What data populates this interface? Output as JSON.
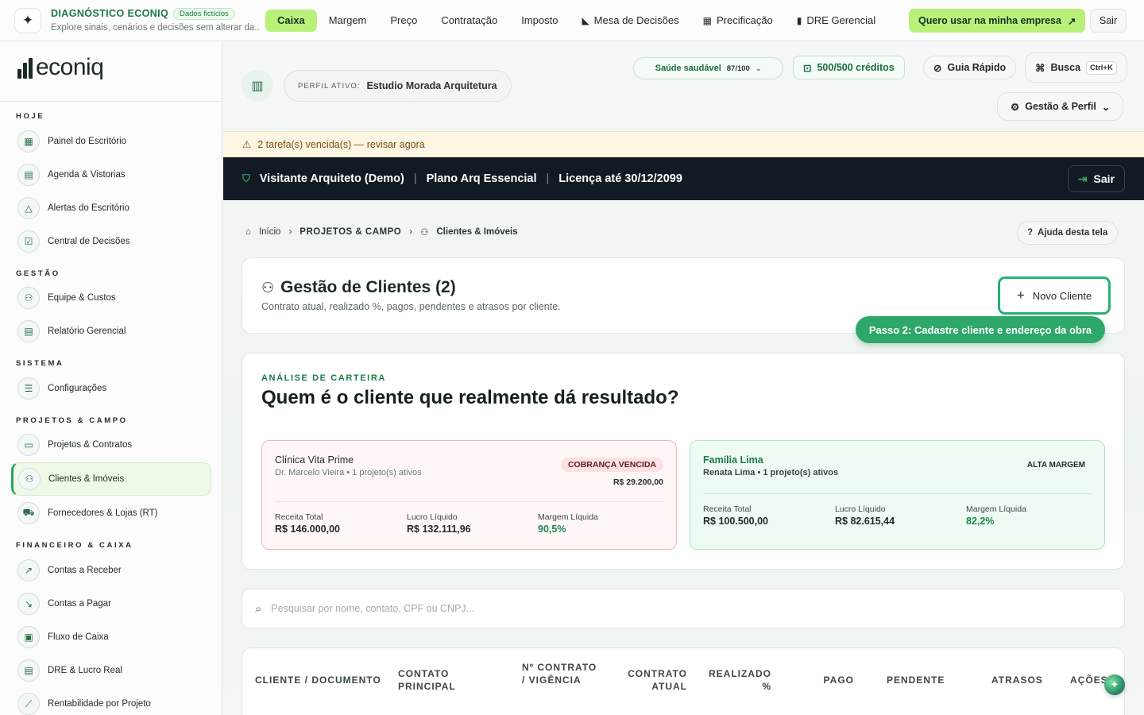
{
  "topbar": {
    "brand": "DIAGNÓSTICO ECONIQ",
    "pill": "Dados fictícios",
    "subtitle": "Explore sinais, cenários e decisões sem alterar da...",
    "tabs": [
      {
        "label": "Caixa",
        "icon": ""
      },
      {
        "label": "Margem",
        "icon": ""
      },
      {
        "label": "Preço",
        "icon": ""
      },
      {
        "label": "Contratação",
        "icon": ""
      },
      {
        "label": "Imposto",
        "icon": ""
      },
      {
        "label": "Mesa de Decisões",
        "icon": "chart-icon"
      },
      {
        "label": "Precificação",
        "icon": "calculator-icon"
      },
      {
        "label": "DRE Gerencial",
        "icon": "file-icon"
      }
    ],
    "cta": "Quero usar na minha empresa",
    "exit": "Sair"
  },
  "sidebar": {
    "logo": "econiq",
    "sections": [
      {
        "title": "HOJE",
        "items": [
          "Painel do Escritório",
          "Agenda & Vistorias",
          "Alertas do Escritório",
          "Central de Decisões"
        ]
      },
      {
        "title": "GESTÃO",
        "items": [
          "Equipe & Custos",
          "Relatório Gerencial"
        ]
      },
      {
        "title": "SISTEMA",
        "items": [
          "Configurações"
        ]
      },
      {
        "title": "PROJETOS & CAMPO",
        "items": [
          "Projetos & Contratos",
          "Clientes & Imóveis",
          "Fornecedores & Lojas (RT)"
        ]
      },
      {
        "title": "FINANCEIRO & CAIXA",
        "items": [
          "Contas a Receber",
          "Contas a Pagar",
          "Fluxo de Caixa",
          "DRE & Lucro Real",
          "Rentabilidade por Projeto"
        ]
      }
    ],
    "active_item": "Clientes & Imóveis"
  },
  "header": {
    "profile_label": "PERFIL ATIVO:",
    "profile_value": "Estudio Morada Arquitetura",
    "health": "Saúde saudável",
    "health_score": "87/100",
    "credits": "500/500 créditos",
    "guide": "Guia Rápido",
    "search": "Busca",
    "search_kbd": "Ctrl+K",
    "management": "Gestão & Perfil"
  },
  "alert": "2 tarefa(s) vencida(s) — revisar agora",
  "banner": {
    "user": "Visitante Arquiteto (Demo)",
    "plan": "Plano Arq Essencial",
    "license": "Licença até 30/12/2099",
    "exit": "Sair"
  },
  "breadcrumb": {
    "home": "Início",
    "section": "PROJETOS & CAMPO",
    "current": "Clientes & Imóveis",
    "help": "Ajuda desta tela"
  },
  "page": {
    "title": "Gestão de Clientes (2)",
    "subtitle": "Contrato atual, realizado %, pagos, pendentes e atrasos por cliente.",
    "new_button": "Novo Cliente",
    "tip": "Passo 2: Cadastre cliente e endereço da obra"
  },
  "analysis": {
    "eyebrow": "ANÁLISE DE CARTEIRA",
    "title": "Quem é o cliente que realmente dá resultado?",
    "clients": [
      {
        "name": "Clínica Vita Prime",
        "contact": "Dr. Marcelo Vieira • 1 projeto(s) ativos",
        "badge": "COBRANÇA VENCIDA",
        "overdue": "R$ 29.200,00",
        "revenue_label": "Receita Total",
        "revenue": "R$ 146.000,00",
        "profit_label": "Lucro Líquido",
        "profit": "R$ 132.111,96",
        "margin_label": "Margem Líquida",
        "margin": "90,5%"
      },
      {
        "name": "Família Lima",
        "contact": "Renata Lima • 1 projeto(s) ativos",
        "badge": "ALTA MARGEM",
        "revenue_label": "Receita Total",
        "revenue": "R$ 100.500,00",
        "profit_label": "Lucro Líquido",
        "profit": "R$ 82.615,44",
        "margin_label": "Margem Líquida",
        "margin": "82,2%"
      }
    ]
  },
  "search": {
    "placeholder": "Pesquisar por nome, contato, CPF ou CNPJ..."
  },
  "table": {
    "headers": [
      "CLIENTE / DOCUMENTO",
      "CONTATO PRINCIPAL",
      "Nº CONTRATO / VIGÊNCIA",
      "CONTRATO ATUAL",
      "REALIZADO %",
      "PAGO",
      "PENDENTE",
      "ATRASOS",
      "AÇÕES"
    ]
  },
  "colors": {
    "accent": "#b9f07a",
    "brand_green": "#1c7a4a",
    "dark_banner": "#121a24",
    "alert_bg": "#fdf6e3"
  }
}
